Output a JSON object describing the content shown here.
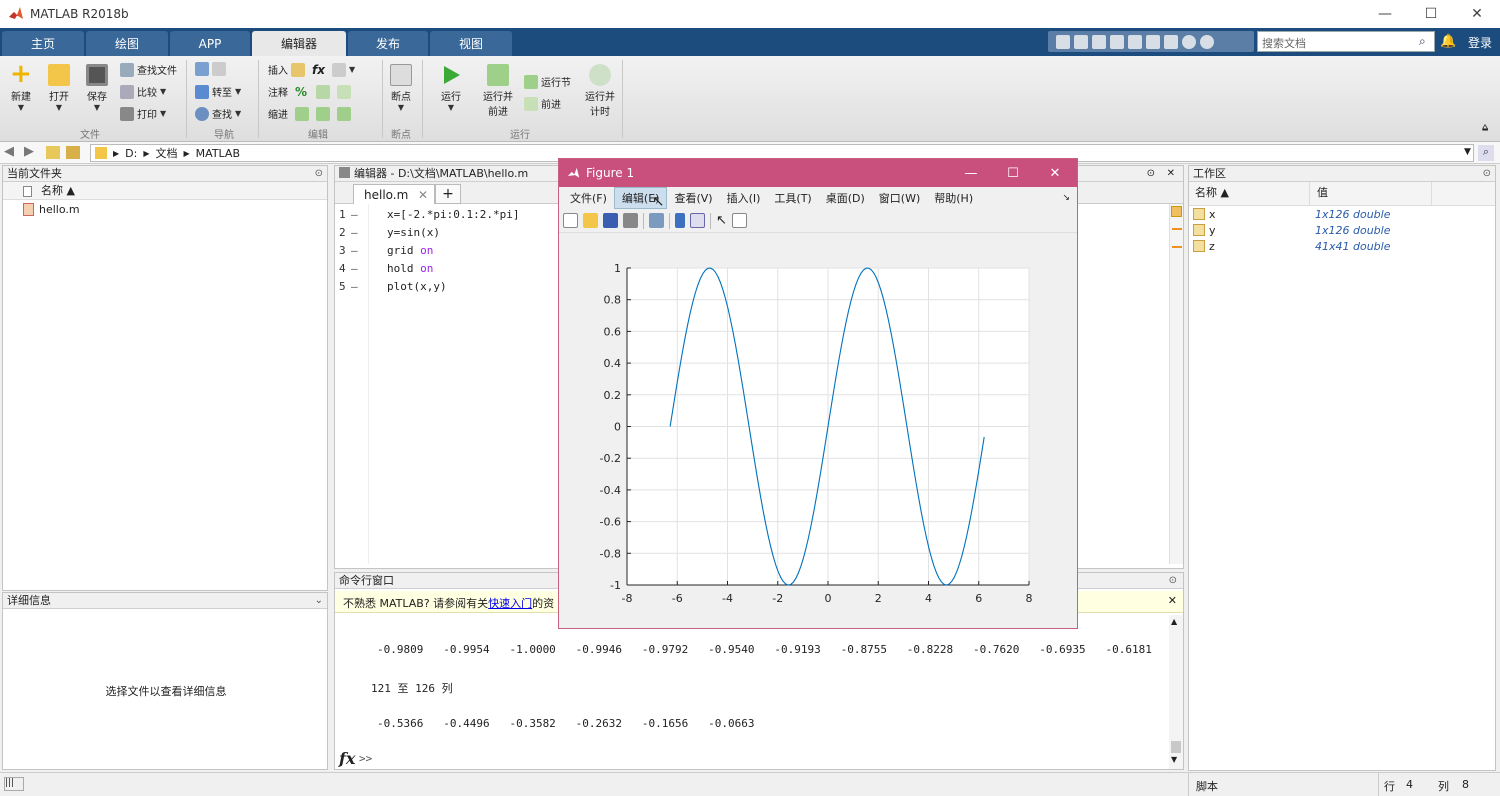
{
  "window": {
    "title": "MATLAB R2018b"
  },
  "tabs": [
    {
      "label": "主页",
      "active": false
    },
    {
      "label": "绘图",
      "active": false
    },
    {
      "label": "APP",
      "active": false
    },
    {
      "label": "编辑器",
      "active": true
    },
    {
      "label": "发布",
      "active": false
    },
    {
      "label": "视图",
      "active": false
    }
  ],
  "search": {
    "placeholder": "搜索文档"
  },
  "account": {
    "login_label": "登录"
  },
  "ribbon": {
    "new": "新建",
    "open": "打开",
    "save": "保存",
    "find_files": "查找文件",
    "compare": "比较",
    "print": "打印",
    "goto": "转至",
    "find": "查找",
    "insert": "插入",
    "comment": "注释",
    "indent": "缩进",
    "breakpoints": "断点",
    "run": "运行",
    "run_advance_l1": "运行并",
    "run_advance_l2": "前进",
    "run_section": "运行节",
    "advance": "前进",
    "run_time_l1": "运行并",
    "run_time_l2": "计时",
    "groups": {
      "file": "文件",
      "navigate": "导航",
      "edit": "编辑",
      "breakpoints": "断点",
      "run": "运行"
    }
  },
  "address": {
    "path": [
      "D:",
      "文档",
      "MATLAB"
    ]
  },
  "current_folder": {
    "title": "当前文件夹",
    "col_name": "名称 ▲",
    "files": [
      "hello.m"
    ]
  },
  "details": {
    "title": "详细信息",
    "hint": "选择文件以查看详细信息"
  },
  "editor": {
    "title": "编辑器 - D:\\文档\\MATLAB\\hello.m",
    "tab": "hello.m",
    "lines": [
      {
        "n": "1",
        "code": "x=[-2.*pi:0.1:2.*pi]",
        "kw": ""
      },
      {
        "n": "2",
        "code": "y=sin(x)",
        "kw": ""
      },
      {
        "n": "3",
        "code": "grid ",
        "kw": "on"
      },
      {
        "n": "4",
        "code": "hold ",
        "kw": "on"
      },
      {
        "n": "5",
        "code": "plot(x,y)",
        "kw": ""
      }
    ]
  },
  "command_window": {
    "title": "命令行窗口",
    "notice_pre": "不熟悉 MATLAB? 请参阅有关",
    "notice_link": "快速入门",
    "notice_post": "的资",
    "row1": "-0.9809   -0.9954   -1.0000   -0.9946   -0.9792   -0.9540   -0.9193   -0.8755   -0.8228   -0.7620   -0.6935   -0.6181",
    "cols_label": "121 至 126 列",
    "row2": "-0.5366   -0.4496   -0.3582   -0.2632   -0.1656   -0.0663",
    "prompt": ">>"
  },
  "workspace": {
    "title": "工作区",
    "col_name": "名称 ▲",
    "col_value": "值",
    "vars": [
      {
        "name": "x",
        "value": "1x126 double"
      },
      {
        "name": "y",
        "value": "1x126 double"
      },
      {
        "name": "z",
        "value": "41x41 double"
      }
    ]
  },
  "figure": {
    "title": "Figure 1",
    "menu": [
      "文件(F)",
      "编辑(E)",
      "查看(V)",
      "插入(I)",
      "工具(T)",
      "桌面(D)",
      "窗口(W)",
      "帮助(H)"
    ]
  },
  "chart_data": {
    "type": "line",
    "title": "",
    "xlabel": "",
    "ylabel": "",
    "xlim": [
      -8,
      8
    ],
    "ylim": [
      -1,
      1
    ],
    "grid": true,
    "xticks": [
      -8,
      -6,
      -4,
      -2,
      0,
      2,
      4,
      6,
      8
    ],
    "yticks": [
      -1,
      -0.8,
      -0.6,
      -0.4,
      -0.2,
      0,
      0.2,
      0.4,
      0.6,
      0.8,
      1
    ],
    "series": [
      {
        "function": "y = sin(x)",
        "x_start": -6.2832,
        "x_step": 0.1,
        "count": 126,
        "color": "#0072bd"
      }
    ]
  },
  "status": {
    "script_label": "脚本",
    "row_label": "行",
    "row": "4",
    "col_label": "列",
    "col": "8"
  },
  "colors": {
    "tabstrip": "#1c4c7e",
    "figure_title": "#c94f7c",
    "plot_line": "#0072bd",
    "keyword": "#a020f0"
  }
}
